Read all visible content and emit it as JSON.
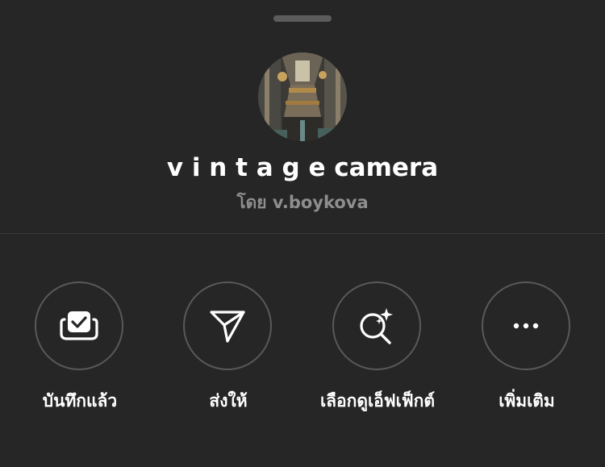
{
  "effect": {
    "name": "v i n t a g e camera",
    "author": "โดย v.boykova"
  },
  "actions": [
    {
      "label": "บันทึกแล้ว",
      "icon": "saved-check-icon"
    },
    {
      "label": "ส่งให้",
      "icon": "send-icon"
    },
    {
      "label": "เลือกดูเอ็ฟเฟ็กต์",
      "icon": "browse-effects-icon"
    },
    {
      "label": "เพิ่มเติม",
      "icon": "more-icon"
    }
  ],
  "colors": {
    "background": "#262626",
    "text_primary": "#ffffff",
    "text_secondary": "#8e8e8e",
    "circle_border": "#595959",
    "divider": "#3a3a3a",
    "grabber": "#5c5c5c"
  }
}
